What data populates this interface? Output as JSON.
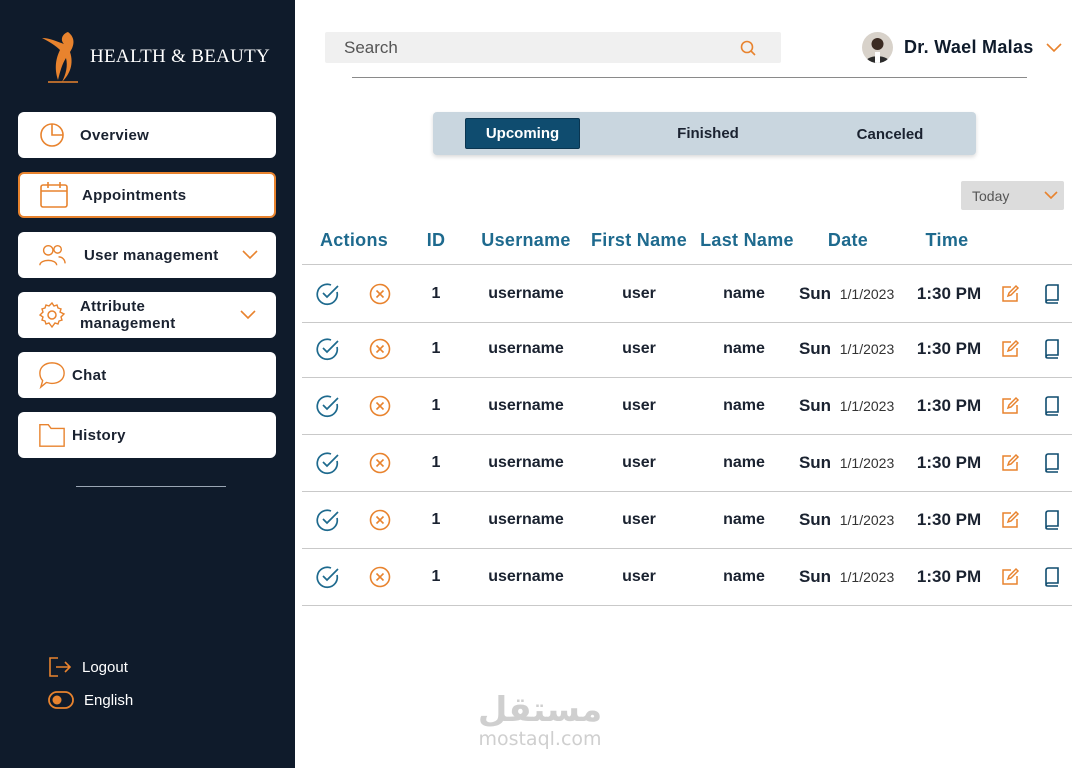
{
  "brand": {
    "name": "HEALTH & BEAUTY"
  },
  "sidebar": {
    "items": [
      {
        "label": "Overview",
        "icon": "pie-chart-icon",
        "active": false,
        "has_chevron": false
      },
      {
        "label": "Appointments",
        "icon": "calendar-icon",
        "active": true,
        "has_chevron": false
      },
      {
        "label": "User management",
        "icon": "users-icon",
        "active": false,
        "has_chevron": true
      },
      {
        "label": "Attribute management",
        "icon": "gear-icon",
        "active": false,
        "has_chevron": true
      },
      {
        "label": "Chat",
        "icon": "chat-bubble-icon",
        "active": false,
        "has_chevron": false
      },
      {
        "label": "History",
        "icon": "folder-icon",
        "active": false,
        "has_chevron": false
      }
    ],
    "logout_label": "Logout",
    "language_label": "English"
  },
  "header": {
    "search_placeholder": "Search",
    "user_name": "Dr. Wael Malas"
  },
  "tabs": [
    {
      "label": "Upcoming",
      "active": true
    },
    {
      "label": "Finished",
      "active": false
    },
    {
      "label": "Canceled",
      "active": false
    }
  ],
  "filter": {
    "selected": "Today"
  },
  "table": {
    "columns": [
      "Actions",
      "ID",
      "Username",
      "First Name",
      "Last Name",
      "Date",
      "Time"
    ],
    "rows": [
      {
        "id": "1",
        "username": "username",
        "first_name": "user",
        "last_name": "name",
        "day": "Sun",
        "date": "1/1/2023",
        "time": "1:30 PM"
      },
      {
        "id": "1",
        "username": "username",
        "first_name": "user",
        "last_name": "name",
        "day": "Sun",
        "date": "1/1/2023",
        "time": "1:30 PM"
      },
      {
        "id": "1",
        "username": "username",
        "first_name": "user",
        "last_name": "name",
        "day": "Sun",
        "date": "1/1/2023",
        "time": "1:30 PM"
      },
      {
        "id": "1",
        "username": "username",
        "first_name": "user",
        "last_name": "name",
        "day": "Sun",
        "date": "1/1/2023",
        "time": "1:30 PM"
      },
      {
        "id": "1",
        "username": "username",
        "first_name": "user",
        "last_name": "name",
        "day": "Sun",
        "date": "1/1/2023",
        "time": "1:30 PM"
      },
      {
        "id": "1",
        "username": "username",
        "first_name": "user",
        "last_name": "name",
        "day": "Sun",
        "date": "1/1/2023",
        "time": "1:30 PM"
      }
    ]
  },
  "watermark": {
    "arabic": "مستقل",
    "latin": "mostaql.com"
  },
  "colors": {
    "sidebar_bg": "#0f1b2b",
    "accent_orange": "#e8832e",
    "heading_blue": "#1e6a8e",
    "tab_active": "#0f4c6f",
    "tabs_bg": "#c9d6df"
  }
}
